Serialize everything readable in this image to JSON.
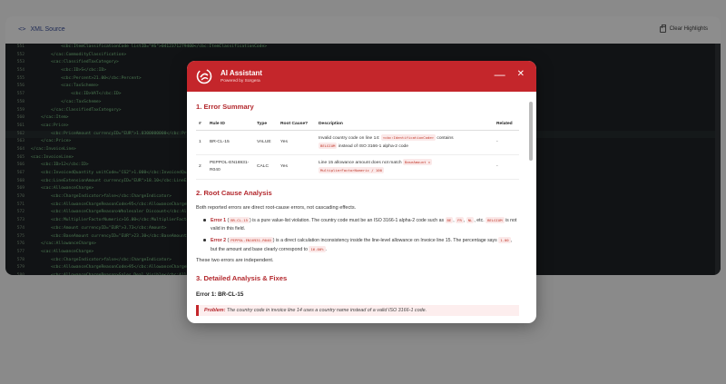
{
  "app": {
    "panel_title": "XML Source",
    "clear_label": "Clear Highlights"
  },
  "code_lines": [
    {
      "n": "551",
      "t": "            <cbc:ItemClassificationCode listID=\"HS\">0412371279400</cbc:ItemClassificationCode>"
    },
    {
      "n": "552",
      "t": "        </cac:CommodityClassification>"
    },
    {
      "n": "553",
      "t": "        <cac:ClassifiedTaxCategory>"
    },
    {
      "n": "554",
      "t": "            <cbc:ID>S</cbc:ID>"
    },
    {
      "n": "555",
      "t": "            <cbc:Percent>21.00</cbc:Percent>"
    },
    {
      "n": "556",
      "t": "            <cac:TaxScheme>"
    },
    {
      "n": "557",
      "t": "                <cbc:ID>VAT</cbc:ID>"
    },
    {
      "n": "558",
      "t": "            </cac:TaxScheme>"
    },
    {
      "n": "559",
      "t": "        </cac:ClassifiedTaxCategory>"
    },
    {
      "n": "560",
      "t": "    </cac:Item>"
    },
    {
      "n": "561",
      "t": "    <cac:Price>"
    },
    {
      "n": "562",
      "t": "        <cbc:PriceAmount currencyID=\"EUR\">1.0300000000</cbc:PriceAmount>"
    },
    {
      "n": "563",
      "t": "    </cac:Price>"
    },
    {
      "n": "564",
      "t": "</cac:InvoiceLine>"
    },
    {
      "n": "565",
      "t": "<cac:InvoiceLine>"
    },
    {
      "n": "566",
      "t": "    <cbc:ID>12</cbc:ID>"
    },
    {
      "n": "567",
      "t": "    <cbc:InvoicedQuantity unitCode=\"C62\">1.000</cbc:InvoicedQuantity>"
    },
    {
      "n": "568",
      "t": "    <cbc:LineExtensionAmount currencyID=\"EUR\">18.10</cbc:LineExtensionAmount>"
    },
    {
      "n": "569",
      "t": "    <cac:AllowanceCharge>"
    },
    {
      "n": "570",
      "t": "        <cbc:ChargeIndicator>false</cbc:ChargeIndicator>"
    },
    {
      "n": "571",
      "t": "        <cbc:AllowanceChargeReasonCode>95</cbc:AllowanceChargeReasonCode>"
    },
    {
      "n": "572",
      "t": "        <cbc:AllowanceChargeReason>Wholesaler Discount</cbc:AllowanceChargeReason>"
    },
    {
      "n": "573",
      "t": "        <cbc:MultiplierFactorNumeric>16.00</cbc:MultiplierFactorNumeric>"
    },
    {
      "n": "574",
      "t": "        <cbc:Amount currencyID=\"EUR\">3.73</cbc:Amount>"
    },
    {
      "n": "575",
      "t": "        <cbc:BaseAmount currencyID=\"EUR\">23.30</cbc:BaseAmount>"
    },
    {
      "n": "576",
      "t": "    </cac:AllowanceCharge>"
    },
    {
      "n": "577",
      "t": "    <cac:AllowanceCharge>"
    },
    {
      "n": "578",
      "t": "        <cbc:ChargeIndicator>false</cbc:ChargeIndicator>"
    },
    {
      "n": "579",
      "t": "        <cbc:AllowanceChargeReasonCode>95</cbc:AllowanceChargeReasonCode>"
    },
    {
      "n": "580",
      "t": "        <cbc:AllowanceChargeReason>Sales Deal Visible</cbc:AllowanceChargeReason>"
    }
  ],
  "modal": {
    "title": "AI Assistant",
    "subtitle": "Powered by Sorgera",
    "s1_title": "1. Error Summary",
    "table": {
      "headers": [
        "#",
        "Rule ID",
        "Type",
        "Root Cause?",
        "Description",
        "Related"
      ],
      "rows": [
        {
          "num": "1",
          "rule": "BR-CL-15",
          "type": "VALUE",
          "root": "Yes",
          "d1": "Invalid country code on line 14:",
          "d1c": "<cbc:IdentificationCode>",
          "d1b": "contains",
          "d2c": "BELGIUM",
          "d2": "instead of ISO 3166-1 alpha-2 code",
          "related": "-"
        },
        {
          "num": "2",
          "rule": "PEPPOL-EN16931-R040",
          "type": "CALC",
          "root": "Yes",
          "d1": "Line 15 allowance amount does not match",
          "d1c": "BaseAmount ×",
          "d2c": "MultiplierFactorNumeric / 100",
          "related": "-"
        }
      ]
    },
    "s2_title": "2. Root Cause Analysis",
    "s2_intro": "Both reported errors are direct root-cause errors, not cascading effects.",
    "err1": {
      "name": "Error 1",
      "code": "BR-CL-15",
      "t1": "is a pure value-list violation. The country code must be an ISO 3166-1 alpha-2 code such as",
      "c2": "BE",
      "c3": "FR",
      "c4": "NL",
      "t2": ", etc.",
      "c5": "BELGIUM",
      "t3": "is not valid in this field."
    },
    "err2": {
      "name": "Error 2",
      "code": "PEPPOL-EN16931-R040",
      "t1": "is a direct calculation inconsistency inside the line-level allowance on Invoice line 15. The percentage says",
      "c2": "1.00",
      "t2": ", but the amount and base clearly correspond to",
      "c3": "16.00%",
      "t3": "."
    },
    "independent": "These two errors are independent.",
    "s3_title": "3. Detailed Analysis & Fixes",
    "s3_sub": "Error 1: BR-CL-15",
    "problem_label": "Problem:",
    "problem_text": "The country code in invoice line 14 uses a country name instead of a valid ISO 3166-1 code."
  },
  "colors": {
    "accent": "#c4262b",
    "code_bg": "#111315",
    "overlay": "#8a8a8a"
  }
}
